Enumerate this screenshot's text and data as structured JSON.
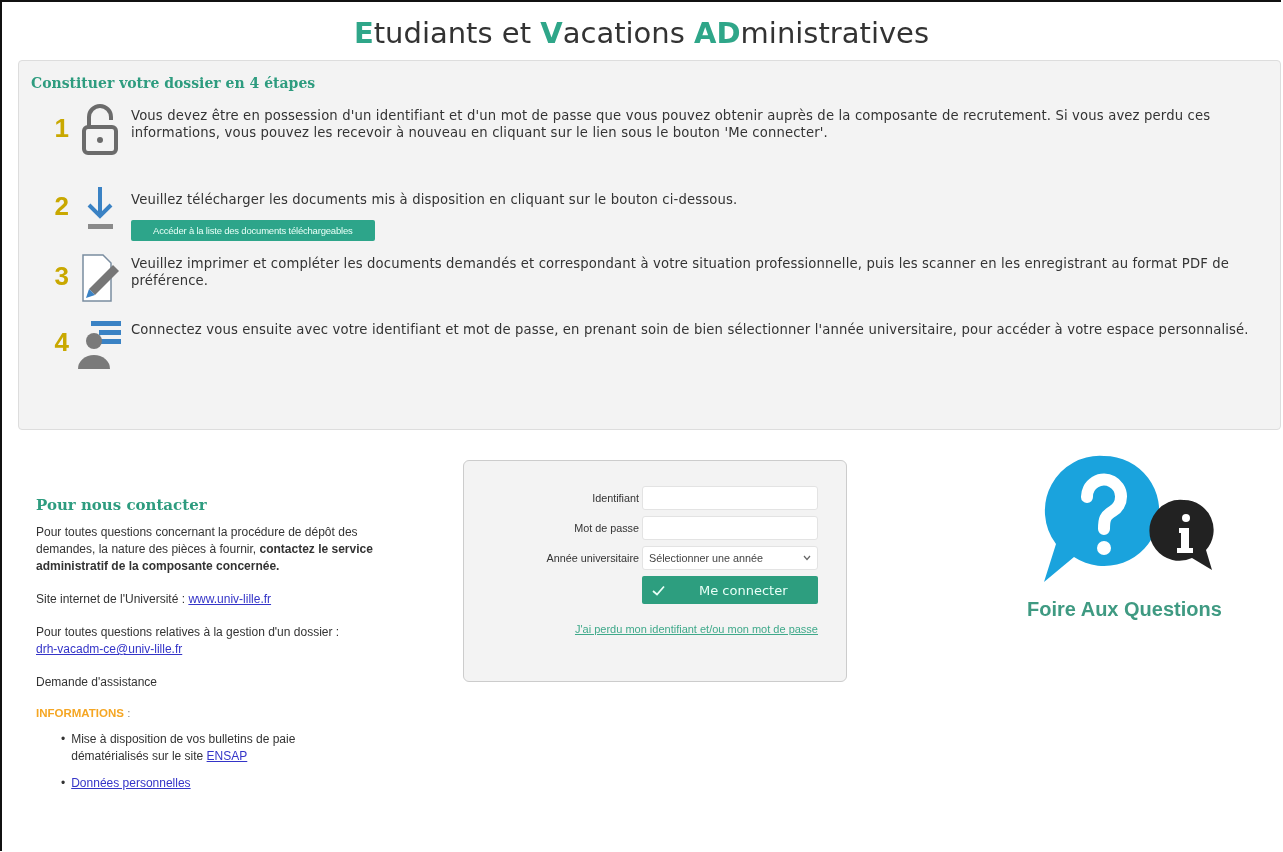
{
  "title": [
    {
      "text": "E",
      "accent": true
    },
    {
      "text": "tudiants et ",
      "accent": false
    },
    {
      "text": "V",
      "accent": true
    },
    {
      "text": "acations ",
      "accent": false
    },
    {
      "text": "AD",
      "accent": true
    },
    {
      "text": "ministratives",
      "accent": false
    }
  ],
  "steps_panel": {
    "heading": "Constituer votre dossier en 4 étapes",
    "steps": [
      {
        "number": "1",
        "kind": "lock",
        "text": "Vous devez être en possession d'un identifiant et d'un mot de passe que vous pouvez obtenir auprès de la composante de recrutement. Si vous avez perdu ces informations, vous pouvez les recevoir à nouveau en cliquant sur le lien sous le bouton 'Me connecter'."
      },
      {
        "number": "2",
        "kind": "download",
        "text": "Veuillez télécharger les documents mis à disposition en cliquant sur le bouton ci-dessous.",
        "button": "Accéder à la liste des documents téléchargeables"
      },
      {
        "number": "3",
        "kind": "document",
        "text": "Veuillez imprimer et compléter les documents demandés et correspondant à votre situation professionnelle, puis les scanner en les enregistrant au format PDF de préférence."
      },
      {
        "number": "4",
        "kind": "user",
        "text": "Connectez vous ensuite avec votre identifiant et mot de passe, en prenant soin de bien sélectionner l'année universitaire, pour accéder à votre espace personnalisé."
      }
    ]
  },
  "contact": {
    "heading": "Pour nous contacter",
    "paragraphs": [
      {
        "text": "Pour toutes questions concernant la procédure de dépôt des demandes, la nature des pièces à fournir, **contactez le service administratif de la composante concernée.**"
      },
      {
        "text": "Site internet de l'Université : ",
        "link": "www.univ-lille.fr"
      },
      {
        "text": "Pour toutes questions relatives à la gestion d'un dossier :",
        "link": "drh-vacadm-ce@univ-lille.fr",
        "link_block": true
      },
      {
        "text": "Demande d'assistance"
      }
    ],
    "info_heading": "INFORMATIONS",
    "info_colon": ":",
    "info_items": [
      {
        "bullet": "•",
        "text": "Mise à disposition de vos bulletins de paie dématérialisés sur le site ",
        "link": "ENSAP"
      },
      {
        "bullet": "•",
        "link": "Données personnelles"
      }
    ]
  },
  "login": {
    "fields": [
      {
        "label": "Identifiant",
        "kind": "text"
      },
      {
        "label": "Mot de passe",
        "kind": "password"
      },
      {
        "label": "Année universitaire",
        "kind": "select",
        "value": "Sélectionner une année"
      }
    ],
    "button": "Me connecter",
    "lost_link": "J'ai perdu mon identifiant et/ou mon mot de passe"
  },
  "faq": {
    "label": "Foire Aux Questions"
  }
}
